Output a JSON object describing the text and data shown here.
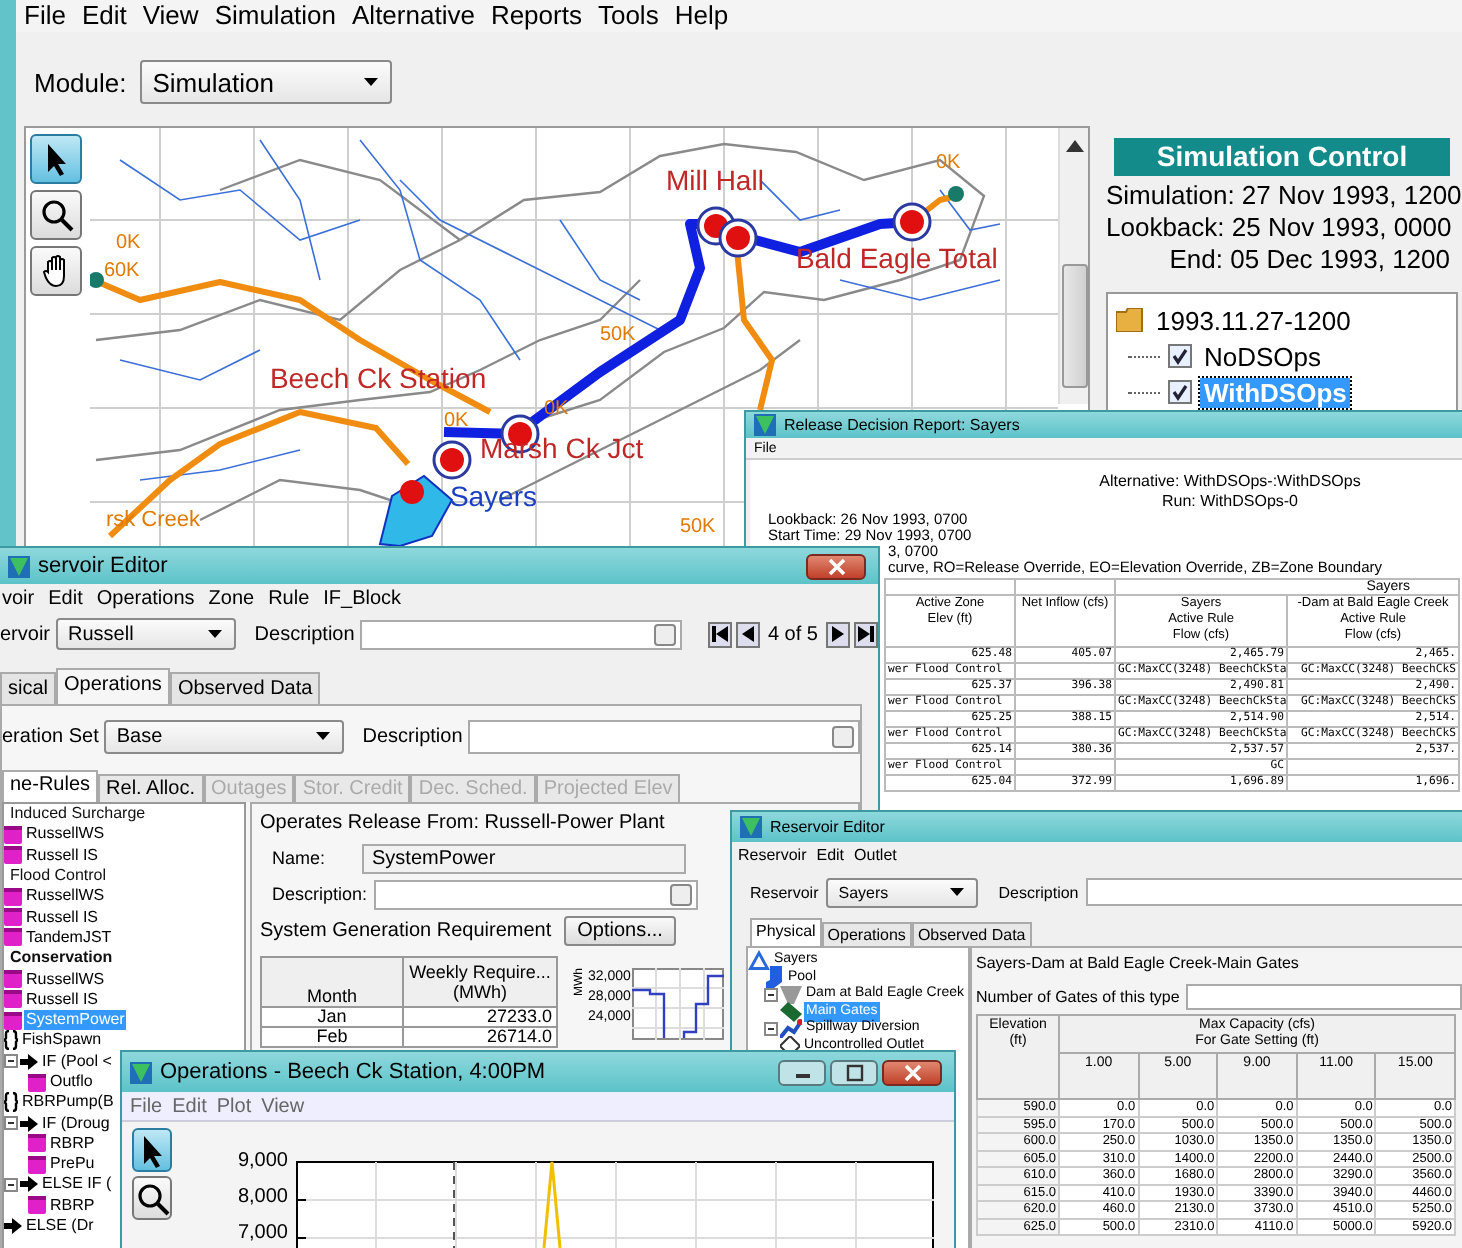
{
  "menu_bar": [
    "File",
    "Edit",
    "View",
    "Simulation",
    "Alternative",
    "Reports",
    "Tools",
    "Help"
  ],
  "module": {
    "label": "Module:",
    "value": "Simulation"
  },
  "map": {
    "tools": [
      {
        "kind": "select",
        "selected": true
      },
      {
        "kind": "zoom",
        "selected": false
      },
      {
        "kind": "pan",
        "selected": false
      }
    ],
    "node_labels": [
      "Mill Hall",
      "Bald Eagle Total",
      "Beech Ck Station",
      "Marsh Ck Jct",
      "Sayers"
    ],
    "flow_labels": [
      "0K",
      "0K",
      "60K",
      "50K",
      "0K",
      "0K",
      "50K"
    ],
    "stream_label": "rsk Creek"
  },
  "simulation_control": {
    "title": "Simulation Control",
    "lines": [
      "Simulation: 27 Nov 1993, 1200",
      "Lookback: 25 Nov 1993, 0000",
      "End: 05 Dec 1993, 1200"
    ],
    "tree": {
      "label": "1993.11.27-1200",
      "selected": false,
      "children": [
        {
          "label": "NoDSOps",
          "checked": true,
          "selected": false
        },
        {
          "label": "WithDSOps",
          "checked": true,
          "selected": true
        }
      ]
    }
  },
  "report_window": {
    "title": "Release Decision Report: Sayers",
    "menu": [
      "File"
    ],
    "header": [
      "Alternative: WithDSOps-:WithDSOps",
      "Run: WithDSOps-0"
    ],
    "info": [
      "Lookback: 26 Nov 1993, 0700",
      "Start Time: 29 Nov 1993, 0700",
      "3, 0700",
      "curve, RO=Release Override, EO=Elevation Override, ZB=Zone Boundary"
    ],
    "group_header": "Sayers",
    "columns": [
      "Active Zone\nElev (ft)",
      "Net Inflow (cfs)",
      "Sayers\nActive Rule\nFlow (cfs)",
      "-Dam at Bald Eagle Creek\nActive Rule\nFlow (cfs)"
    ],
    "rows": [
      [
        "625.48",
        "405.07",
        "2,465.79",
        "2,465."
      ],
      [
        "wer Flood Control",
        null,
        "GC:MaxCC(3248) BeechCkSta",
        "GC:MaxCC(3248) BeechCkS"
      ],
      [
        "625.37",
        "396.38",
        "2,490.81",
        "2,490."
      ],
      [
        "wer Flood Control",
        null,
        "GC:MaxCC(3248) BeechCkSta",
        "GC:MaxCC(3248) BeechCkS"
      ],
      [
        "625.25",
        "388.15",
        "2,514.90",
        "2,514."
      ],
      [
        "wer Flood Control",
        null,
        "GC:MaxCC(3248) BeechCkSta",
        "GC:MaxCC(3248) BeechCkS"
      ],
      [
        "625.14",
        "380.36",
        "2,537.57",
        "2,537."
      ],
      [
        "wer Flood Control",
        null,
        "GC",
        null
      ],
      [
        "625.04",
        "372.99",
        "1,696.89",
        "1,696."
      ]
    ]
  },
  "russell_editor": {
    "title": "servoir Editor",
    "menu": [
      "voir",
      "Edit",
      "Operations",
      "Zone",
      "Rule",
      "IF_Block"
    ],
    "reservoir_label": "ervoir",
    "reservoir": "Russell",
    "description_label": "Description",
    "record": "4 of 5",
    "tabs": [
      {
        "label": "sical",
        "selected": false
      },
      {
        "label": "Operations",
        "selected": true
      },
      {
        "label": "Observed Data",
        "selected": false
      }
    ],
    "operation_set_label": "eration Set",
    "operation_set": "Base",
    "operation_description_label": "Description",
    "subtabs": [
      {
        "label": "ne-Rules",
        "selected": true,
        "disabled": false
      },
      {
        "label": "Rel. Alloc.",
        "selected": false,
        "disabled": false
      },
      {
        "label": "Outages",
        "selected": false,
        "disabled": true
      },
      {
        "label": "Stor. Credit",
        "selected": false,
        "disabled": true
      },
      {
        "label": "Dec. Sched.",
        "selected": false,
        "disabled": true
      },
      {
        "label": "Projected Elev",
        "selected": false,
        "disabled": true
      }
    ],
    "rules_tree": [
      {
        "label": "Induced Surcharge",
        "kind": "zone",
        "active": false,
        "selected": false,
        "children": [
          {
            "label": "RussellWS",
            "kind": "rule",
            "selected": false
          },
          {
            "label": "Russell IS",
            "kind": "rule",
            "selected": false
          }
        ]
      },
      {
        "label": "Flood Control",
        "kind": "zone",
        "active": false,
        "selected": false,
        "children": [
          {
            "label": "RussellWS",
            "kind": "rule",
            "selected": false
          },
          {
            "label": "Russell IS",
            "kind": "rule",
            "selected": false
          },
          {
            "label": "TandemJST",
            "kind": "rule",
            "selected": false
          }
        ]
      },
      {
        "label": "Conservation",
        "kind": "zone",
        "active": true,
        "selected": false,
        "children": [
          {
            "label": "RussellWS",
            "kind": "rule",
            "selected": false
          },
          {
            "label": "Russell IS",
            "kind": "rule",
            "selected": false
          },
          {
            "label": "SystemPower",
            "kind": "rule",
            "selected": true
          },
          {
            "label": "FishSpawn",
            "kind": "block",
            "selected": false,
            "children": [
              {
                "label": "IF (Pool <",
                "kind": "if",
                "selected": false,
                "children": [
                  {
                    "label": "Outflo",
                    "kind": "rule",
                    "selected": false
                  }
                ]
              }
            ]
          },
          {
            "label": "RBRPump(B",
            "kind": "block",
            "selected": false,
            "children": [
              {
                "label": "IF (Droug",
                "kind": "if",
                "selected": false,
                "children": [
                  {
                    "label": "RBRP",
                    "kind": "rule",
                    "selected": false
                  },
                  {
                    "label": "PrePu",
                    "kind": "rule",
                    "selected": false
                  }
                ]
              },
              {
                "label": "ELSE IF (",
                "kind": "if",
                "selected": false,
                "children": [
                  {
                    "label": "RBRP",
                    "kind": "rule",
                    "selected": false
                  }
                ]
              },
              {
                "label": "ELSE (Dr",
                "kind": "if",
                "selected": false
              }
            ]
          }
        ]
      }
    ],
    "rule": {
      "heading": "Operates Release From: Russell-Power Plant",
      "name_label": "Name:",
      "name": "SystemPower",
      "description_label": "Description:",
      "requirement_label": "System Generation Requirement",
      "options_button": "Options...",
      "columns": [
        "Month",
        "Weekly Require...\n(MWh)"
      ],
      "rows": [
        [
          "Jan",
          "27233.0"
        ],
        [
          "Feb",
          "26714.0"
        ]
      ],
      "chart_ticks": [
        "32,000",
        "28,000",
        "24,000"
      ],
      "chart_unit": "MWh"
    }
  },
  "sayers_editor": {
    "title": "Reservoir Editor",
    "menu": [
      "Reservoir",
      "Edit",
      "Outlet"
    ],
    "reservoir_label": "Reservoir",
    "reservoir": "Sayers",
    "description_label": "Description",
    "tabs": [
      {
        "label": "Physical",
        "selected": true
      },
      {
        "label": "Operations",
        "selected": false
      },
      {
        "label": "Observed Data",
        "selected": false
      }
    ],
    "tree": [
      {
        "label": "Sayers",
        "kind": "reservoir",
        "selected": false,
        "children": [
          {
            "label": "Pool",
            "kind": "pool",
            "selected": false
          },
          {
            "label": "Dam at Bald Eagle Creek",
            "kind": "dam",
            "selected": false,
            "children": [
              {
                "label": "Main Gates",
                "kind": "gate",
                "selected": true
              }
            ]
          },
          {
            "label": "Spillway Diversion",
            "kind": "diversion",
            "selected": false,
            "children": [
              {
                "label": "Uncontrolled Outlet",
                "kind": "outlet",
                "selected": false
              }
            ]
          }
        ]
      }
    ],
    "heading": "Sayers-Dam at Bald Eagle Creek-Main Gates",
    "gates_label": "Number of Gates of this type",
    "elevation_header": "Elevation\n(ft)",
    "capacity_header": "Max Capacity (cfs)\nFor Gate Setting (ft)",
    "settings": [
      "1.00",
      "5.00",
      "9.00",
      "11.00",
      "15.00"
    ],
    "rows": [
      [
        "590.0",
        "0.0",
        "0.0",
        "0.0",
        "0.0",
        "0.0"
      ],
      [
        "595.0",
        "170.0",
        "500.0",
        "500.0",
        "500.0",
        "500.0"
      ],
      [
        "600.0",
        "250.0",
        "1030.0",
        "1350.0",
        "1350.0",
        "1350.0"
      ],
      [
        "605.0",
        "310.0",
        "1400.0",
        "2200.0",
        "2440.0",
        "2500.0"
      ],
      [
        "610.0",
        "360.0",
        "1680.0",
        "2800.0",
        "3290.0",
        "3560.0"
      ],
      [
        "615.0",
        "410.0",
        "1930.0",
        "3390.0",
        "3940.0",
        "4460.0"
      ],
      [
        "620.0",
        "460.0",
        "2130.0",
        "3730.0",
        "4510.0",
        "5250.0"
      ],
      [
        "625.0",
        "500.0",
        "2310.0",
        "4110.0",
        "5000.0",
        "5920.0"
      ]
    ]
  },
  "operations_window": {
    "title": "Operations - Beech Ck Station, 4:00PM",
    "menu": [
      "File",
      "Edit",
      "Plot",
      "View"
    ],
    "tools": [
      {
        "kind": "select",
        "selected": true
      },
      {
        "kind": "zoom",
        "selected": false
      }
    ],
    "yticks": [
      "9,000",
      "8,000",
      "7,000"
    ]
  }
}
